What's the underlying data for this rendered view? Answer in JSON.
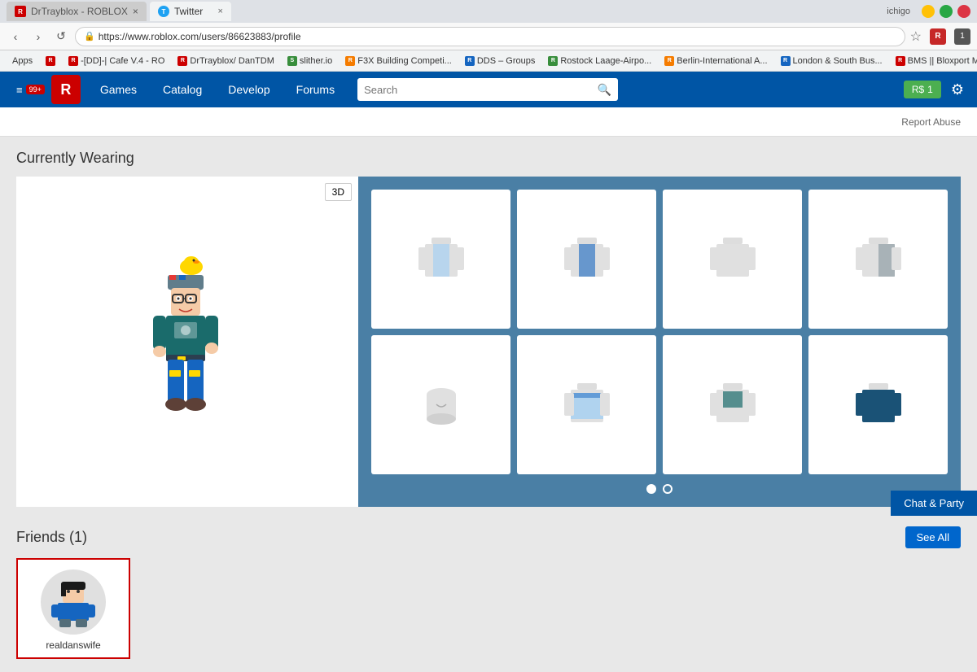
{
  "browser": {
    "tabs": [
      {
        "id": "roblox-tab",
        "label": "DrTrayblox - ROBLOX",
        "favicon": "R",
        "active": false
      },
      {
        "id": "twitter-tab",
        "label": "Twitter",
        "favicon": "T",
        "active": true
      }
    ],
    "url": "https://www.roblox.com/users/86623883/profile",
    "user": "ichigo",
    "window_controls": [
      "minimize",
      "maximize",
      "close"
    ]
  },
  "bookmarks": [
    {
      "id": "apps",
      "label": "Apps"
    },
    {
      "id": "roblox1",
      "label": "R",
      "short": true
    },
    {
      "id": "cafev4",
      "label": "-[DD]-| Cafe V.4 - RO"
    },
    {
      "id": "drtrayblox",
      "label": "DrTrayblox/ DanTDM"
    },
    {
      "id": "slither",
      "label": "slither.io"
    },
    {
      "id": "f3x",
      "label": "F3X Building Competi..."
    },
    {
      "id": "dds",
      "label": "DDS – Groups"
    },
    {
      "id": "rostock",
      "label": "Rostock Laage-Airpo..."
    },
    {
      "id": "berlin",
      "label": "Berlin-International A..."
    },
    {
      "id": "london",
      "label": "London & South Bus..."
    },
    {
      "id": "bms",
      "label": "BMS || Bloxport Midd..."
    }
  ],
  "roblox_nav": {
    "notification_count": "99+",
    "links": [
      "Games",
      "Catalog",
      "Develop",
      "Forums"
    ],
    "search_placeholder": "Search",
    "robux_count": "1",
    "settings_label": "Settings"
  },
  "page": {
    "report_abuse": "Report Abuse",
    "currently_wearing_title": "Currently Wearing",
    "btn_3d": "3D",
    "friends_title": "Friends (1)",
    "see_all": "See All",
    "chat_party": "Chat & Party",
    "friend": {
      "name": "realdanswife"
    }
  },
  "pagination": {
    "dots": [
      {
        "active": true
      },
      {
        "active": false
      }
    ]
  },
  "icons": {
    "back": "‹",
    "forward": "›",
    "reload": "↺",
    "lock": "🔒",
    "star": "☆",
    "search": "🔍",
    "settings": "⚙",
    "robux": "R$",
    "menu": "≡",
    "close_tab": "×"
  }
}
